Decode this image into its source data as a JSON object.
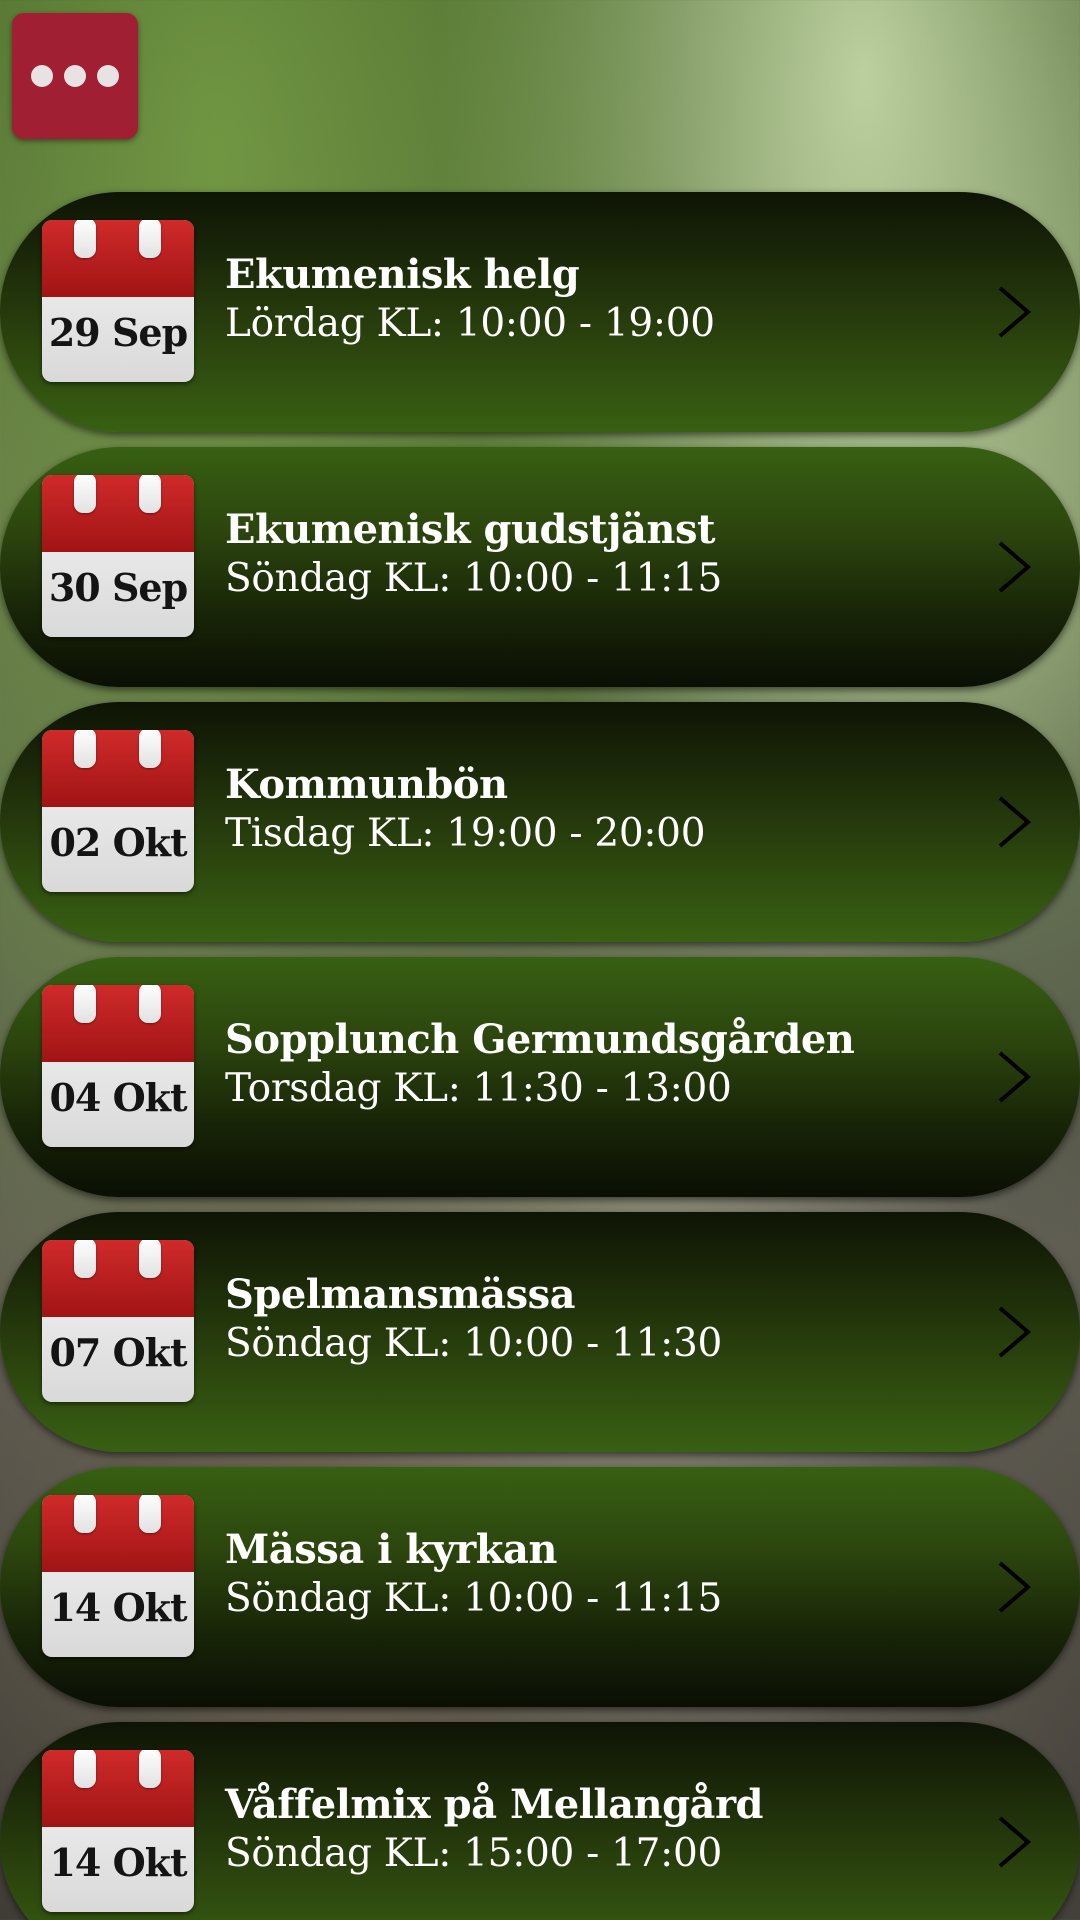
{
  "menu": {
    "icon": "more-horizontal-icon",
    "color": "#a11f32"
  },
  "colors": {
    "calendar_red": "#c02020",
    "row_green": "#376012",
    "row_dark": "#0e1405",
    "text": "#ffffff"
  },
  "events": [
    {
      "date": "29 Sep",
      "title": "Ekumenisk helg",
      "time": "Lördag KL: 10:00 - 19:00"
    },
    {
      "date": "30 Sep",
      "title": "Ekumenisk gudstjänst",
      "time": "Söndag KL: 10:00 - 11:15"
    },
    {
      "date": "02 Okt",
      "title": "Kommunbön",
      "time": "Tisdag KL: 19:00 - 20:00"
    },
    {
      "date": "04 Okt",
      "title": "Sopplunch Germundsgården",
      "time": "Torsdag KL: 11:30 - 13:00"
    },
    {
      "date": "07 Okt",
      "title": "Spelmansmässa",
      "time": "Söndag KL: 10:00 - 11:30"
    },
    {
      "date": "14 Okt",
      "title": "Mässa i kyrkan",
      "time": "Söndag KL: 10:00 - 11:15"
    },
    {
      "date": "14 Okt",
      "title": "Våffelmix på Mellangård",
      "time": "Söndag KL: 15:00 - 17:00"
    }
  ]
}
